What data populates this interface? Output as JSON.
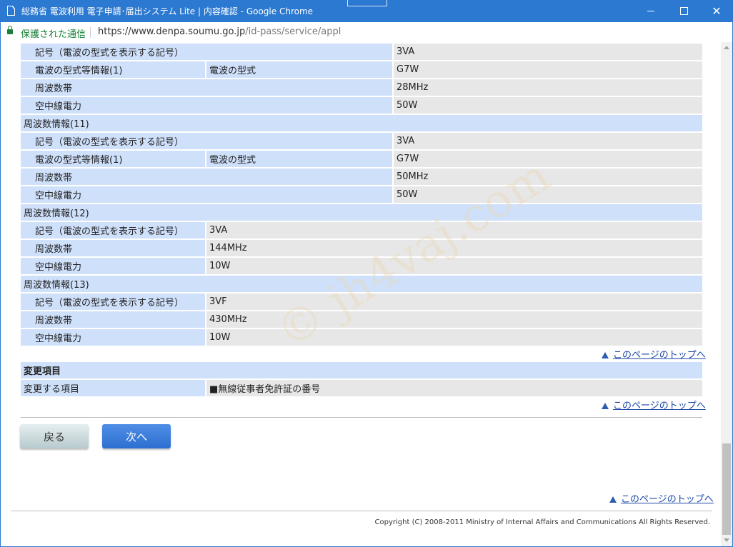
{
  "window": {
    "title": "総務省 電波利用 電子申請･届出システム Lite | 内容確認 - Google Chrome",
    "secure_label": "保護された通信",
    "url_host": "https://www.denpa.soumu.go.jp",
    "url_path": "/id-pass/service/appl"
  },
  "rows": {
    "r0": {
      "label": "記号（電波の型式を表示する記号）",
      "value": "3VA"
    },
    "r1": {
      "label": "電波の型式等情報(1)",
      "sub": "電波の型式",
      "value": "G7W"
    },
    "r2": {
      "label": "周波数帯",
      "value": "28MHz"
    },
    "r3": {
      "label": "空中線電力",
      "value": "50W"
    },
    "s11": "周波数情報(11)",
    "r4": {
      "label": "記号（電波の型式を表示する記号）",
      "value": "3VA"
    },
    "r5": {
      "label": "電波の型式等情報(1)",
      "sub": "電波の型式",
      "value": "G7W"
    },
    "r6": {
      "label": "周波数帯",
      "value": "50MHz"
    },
    "r7": {
      "label": "空中線電力",
      "value": "50W"
    },
    "s12": "周波数情報(12)",
    "r8": {
      "label": "記号（電波の型式を表示する記号）",
      "value": "3VA"
    },
    "r9": {
      "label": "周波数帯",
      "value": "144MHz"
    },
    "r10": {
      "label": "空中線電力",
      "value": "10W"
    },
    "s13": "周波数情報(13)",
    "r11": {
      "label": "記号（電波の型式を表示する記号）",
      "value": "3VF"
    },
    "r12": {
      "label": "周波数帯",
      "value": "430MHz"
    },
    "r13": {
      "label": "空中線電力",
      "value": "10W"
    }
  },
  "change": {
    "heading": "変更項目",
    "label": "変更する項目",
    "value": "■無線従事者免許証の番号"
  },
  "links": {
    "page_top": "このページのトップへ"
  },
  "buttons": {
    "back": "戻る",
    "next": "次へ"
  },
  "footer": {
    "copyright": "Copyright (C) 2008-2011 Ministry of Internal Affairs and Communications All Rights Reserved."
  },
  "watermark": "© jh4vaj.com",
  "colors": {
    "label_bg": "#cfe0fb",
    "value_bg": "#e7e7e7",
    "link": "#1a47a6",
    "primary_button": "#2d6fd0"
  }
}
